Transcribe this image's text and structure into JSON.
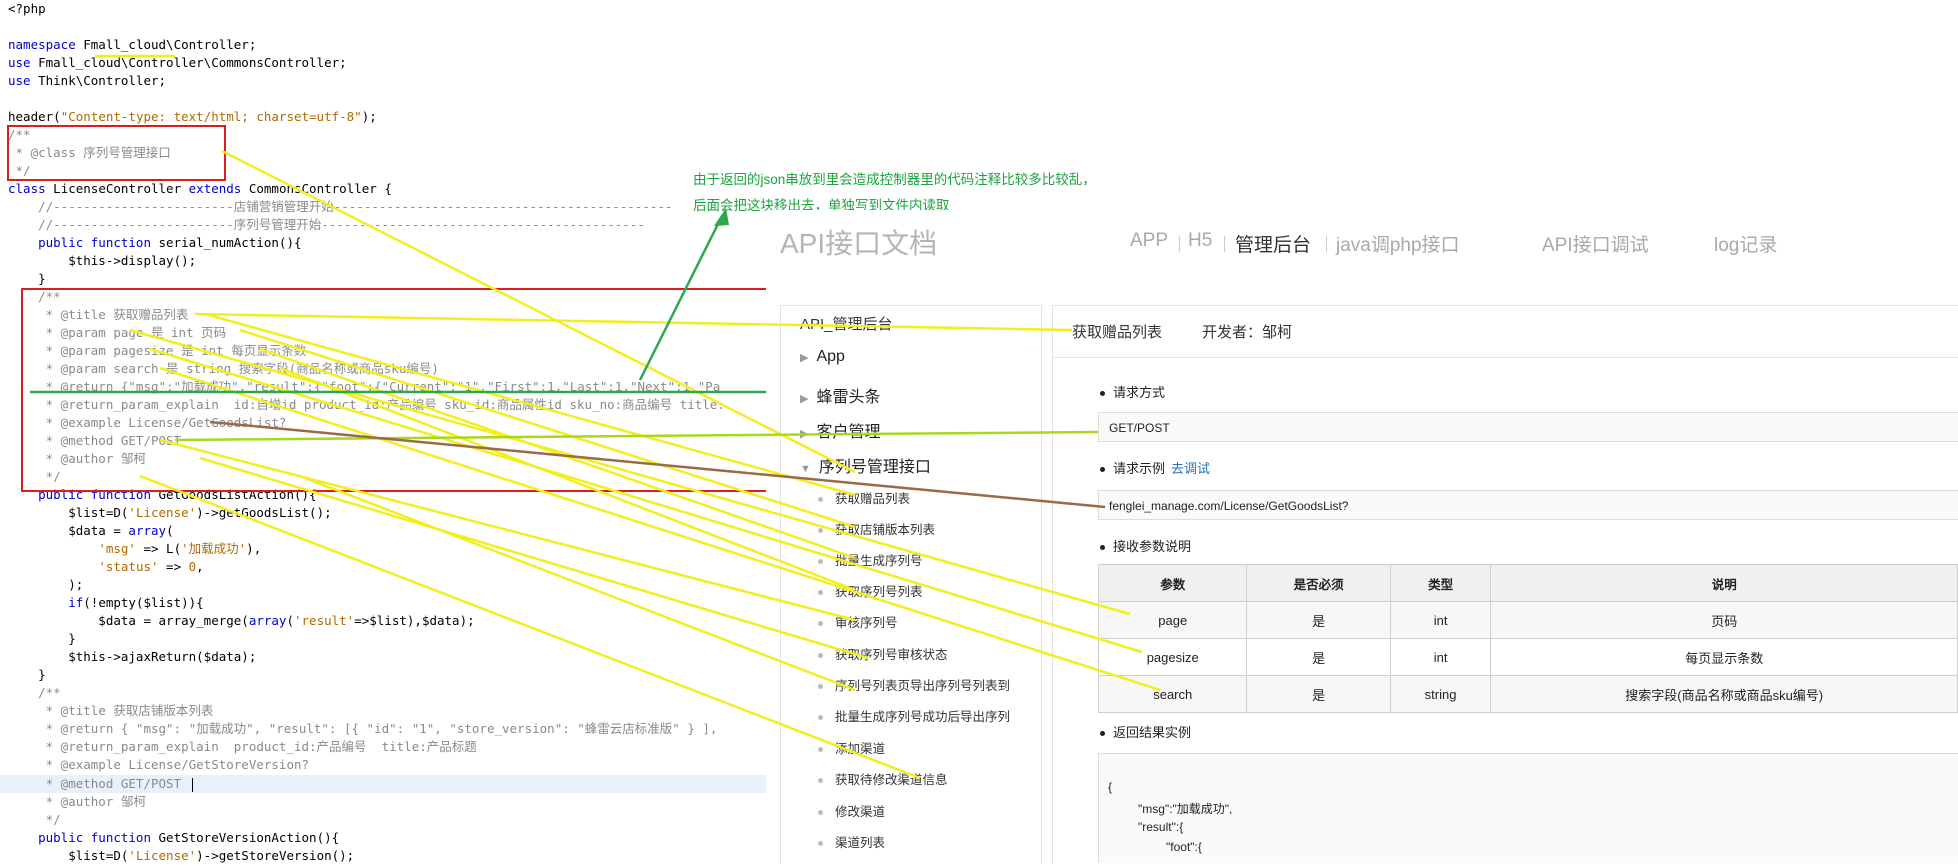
{
  "code": [
    {
      "t": "<?php"
    },
    {
      "t": ""
    },
    {
      "t": "namespace Fmall_cloud\\Controller;"
    },
    {
      "t": "use Fmall_cloud\\Controller\\CommonsController;"
    },
    {
      "t": "use Think\\Controller;"
    },
    {
      "t": ""
    },
    {
      "t": "header(\"Content-type: text/html; charset=utf-8\");"
    },
    {
      "t": "/**"
    },
    {
      "t": " * @class 序列号管理接口"
    },
    {
      "t": " */"
    },
    {
      "t": "class LicenseController extends CommonsController {"
    },
    {
      "t": "    //------------------------店铺营销管理开始---------------------------------------------"
    },
    {
      "t": "    //------------------------序列号管理开始-------------------------------------------"
    },
    {
      "t": "    public function serial_numAction(){"
    },
    {
      "t": "        $this->display();"
    },
    {
      "t": "    }"
    },
    {
      "t": "    /**"
    },
    {
      "t": "     * @title 获取赠品列表"
    },
    {
      "t": "     * @param page 是 int 页码"
    },
    {
      "t": "     * @param pagesize 是 int 每页显示条数"
    },
    {
      "t": "     * @param search 是 string 搜索字段(商品名称或商品sku编号)"
    },
    {
      "t": "     * @return {\"msg\":\"加载成功\",\"result\":{\"foot\":{\"Current\":\"1\",\"First\":1,\"Last\":1,\"Next\":1,\"Pa"
    },
    {
      "t": "     * @return_param_explain  id:自增id product_id:产品编号 sku_id:商品属性id sku_no:商品编号 title:"
    },
    {
      "t": "     * @example License/GetGoodsList?"
    },
    {
      "t": "     * @method GET/POST"
    },
    {
      "t": "     * @author 邹柯"
    },
    {
      "t": "     */"
    },
    {
      "t": "    public function GetGoodsListAction(){"
    },
    {
      "t": "        $list=D('License')->getGoodsList();"
    },
    {
      "t": "        $data = array("
    },
    {
      "t": "            'msg' => L('加载成功'),"
    },
    {
      "t": "            'status' => 0,"
    },
    {
      "t": "        );"
    },
    {
      "t": "        if(!empty($list)){"
    },
    {
      "t": "            $data = array_merge(array('result'=>$list),$data);"
    },
    {
      "t": "        }"
    },
    {
      "t": "        $this->ajaxReturn($data);"
    },
    {
      "t": "    }"
    },
    {
      "t": "    /**"
    },
    {
      "t": "     * @title 获取店铺版本列表"
    },
    {
      "t": "     * @return { \"msg\": \"加载成功\", \"result\": [{ \"id\": \"1\", \"store_version\": \"蜂雷云店标准版\" } ],"
    },
    {
      "t": "     * @return_param_explain  product_id:产品编号  title:产品标题"
    },
    {
      "t": "     * @example License/GetStoreVersion?"
    },
    {
      "t": "     * @method GET/POST "
    },
    {
      "t": "     * @author 邹柯"
    },
    {
      "t": "     */"
    },
    {
      "t": "    public function GetStoreVersionAction(){"
    },
    {
      "t": "        $list=D('License')->getStoreVersion();"
    }
  ],
  "annotation": {
    "line1": "由于返回的json串放到里会造成控制器里的代码注释比较多比较乱，",
    "line2": "后面会把这块移出去，单独写到文件内读取"
  },
  "doc": {
    "logo": "API接口文档",
    "nav": [
      "APP",
      "H5",
      "管理后台",
      "java调php接口",
      "API接口调试",
      "log记录"
    ],
    "sidebar_title": "API_管理后台",
    "groups": [
      "App",
      "蜂雷头条",
      "客户管理",
      "序列号管理接口"
    ],
    "sub_items": [
      "获取赠品列表",
      "获取店铺版本列表",
      "批量生成序列号",
      "获取序列号列表",
      "审核序列号",
      "获取序列号审核状态",
      "序列号列表页导出序列号列表到",
      "批量生成序列号成功后导出序列",
      "添加渠道",
      "获取待修改渠道信息",
      "修改渠道",
      "渠道列表"
    ],
    "title": "获取赠品列表",
    "developer": "开发者：邹柯",
    "request_method_label": "请求方式",
    "request_method": "GET/POST",
    "example_label": "请求示例",
    "try_link": "去调试",
    "example_url": "fenglei_manage.com/License/GetGoodsList?",
    "params_label": "接收参数说明",
    "params_headers": [
      "参数",
      "是否必须",
      "类型",
      "说明"
    ],
    "params": [
      [
        "page",
        "是",
        "int",
        "页码"
      ],
      [
        "pagesize",
        "是",
        "int",
        "每页显示条数"
      ],
      [
        "search",
        "是",
        "string",
        "搜索字段(商品名称或商品sku编号)"
      ]
    ],
    "result_label": "返回结果实例",
    "result_lines": [
      "{",
      "\"msg\":\"加载成功\",",
      "\"result\":{",
      "\"foot\":{"
    ]
  },
  "colors": {
    "annotation": "#1aa43c",
    "red_box": "#e01b1b",
    "yellow_line": "#f3ef1e",
    "brown_line": "#9b6a48",
    "lime_line": "#a8d81c"
  }
}
